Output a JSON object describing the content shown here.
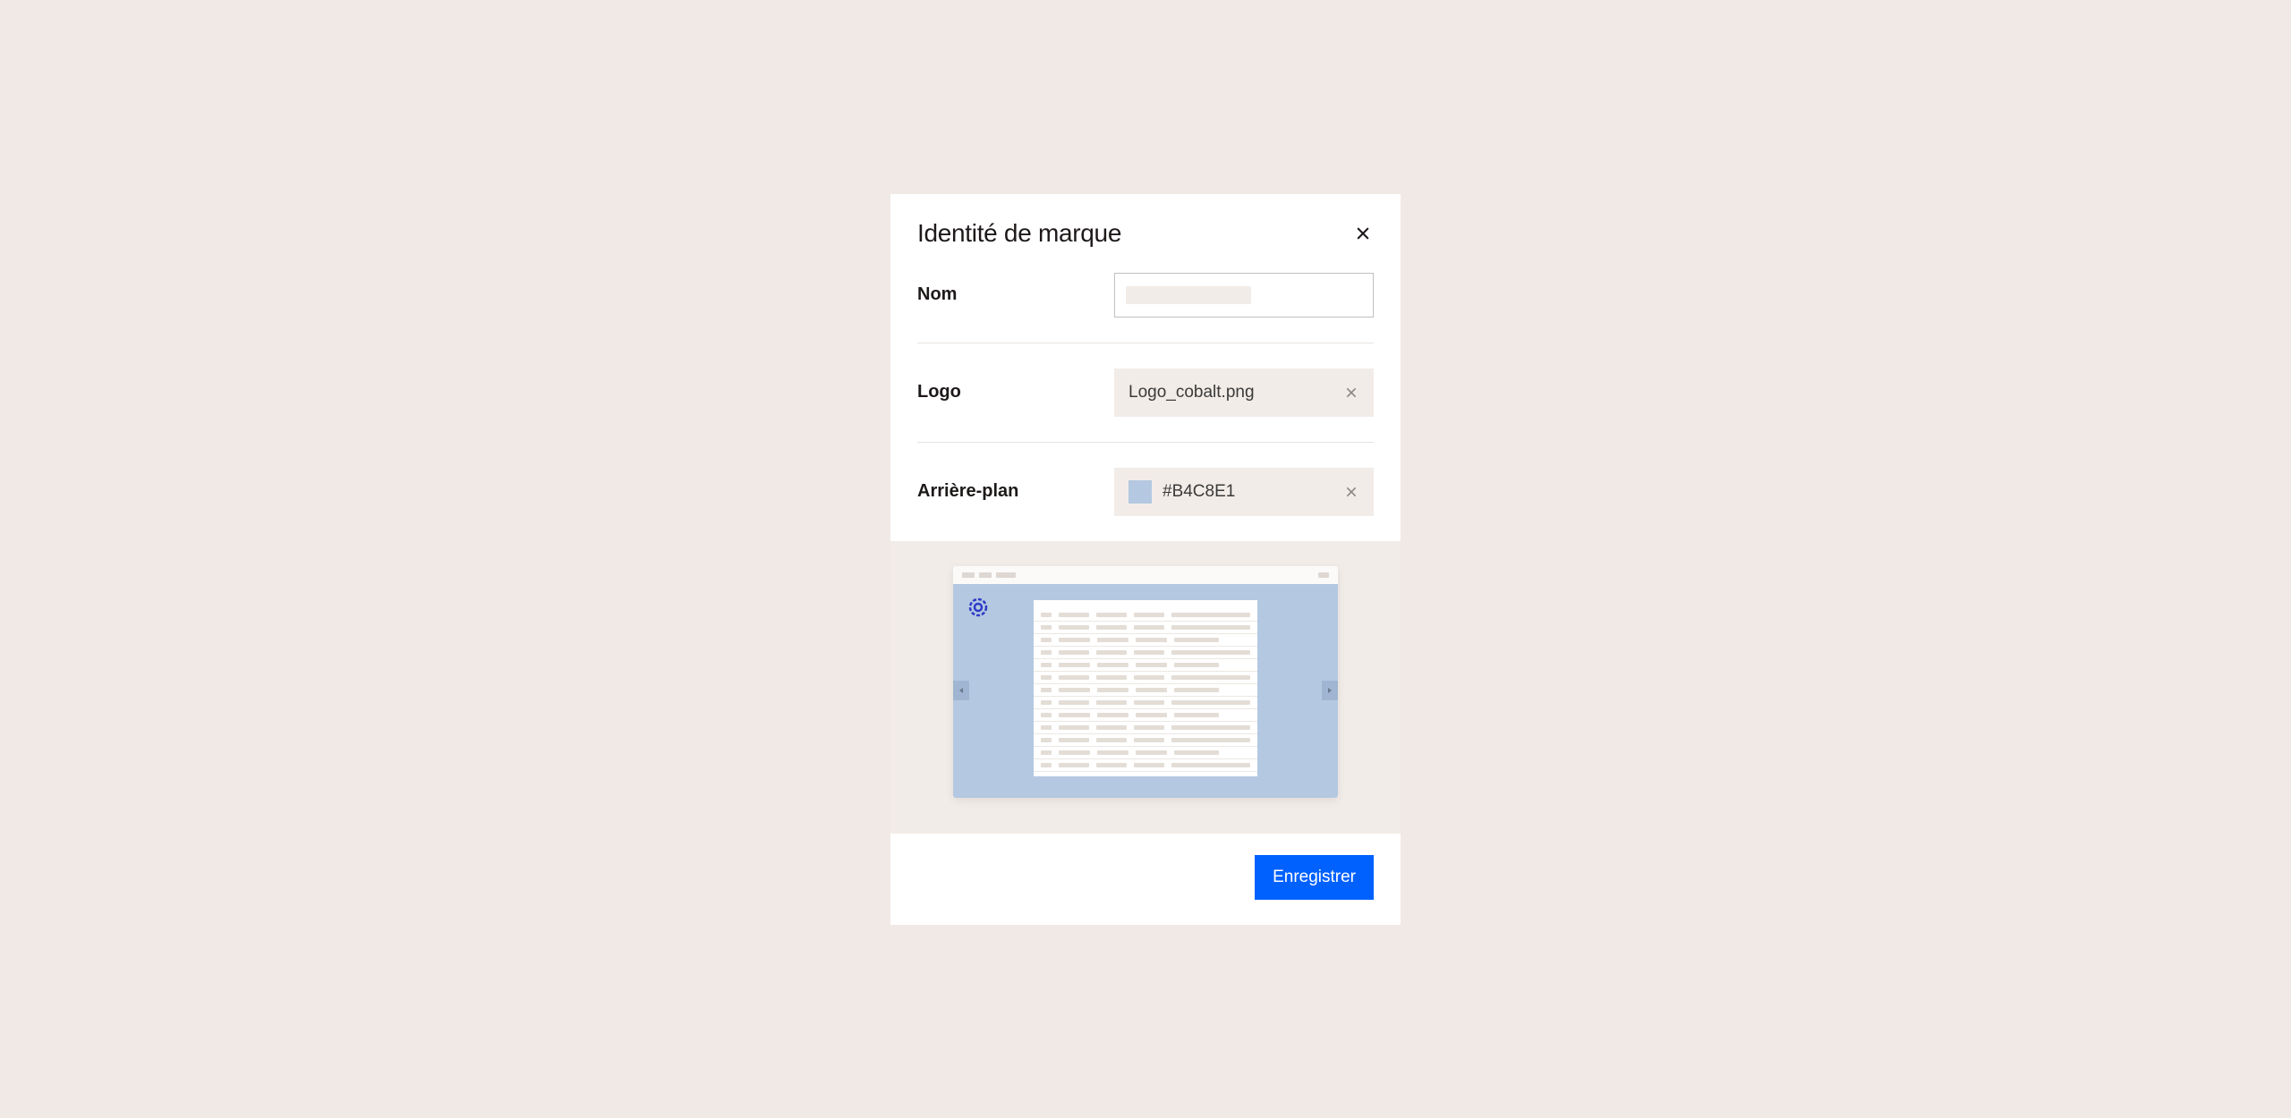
{
  "modal": {
    "title": "Identité de marque",
    "fields": {
      "name": {
        "label": "Nom"
      },
      "logo": {
        "label": "Logo",
        "filename": "Logo_cobalt.png"
      },
      "background": {
        "label": "Arrière-plan",
        "color_hex": "#B4C8E1"
      }
    },
    "save_button_label": "Enregistrer"
  },
  "colors": {
    "background_swatch": "#b4c8e1",
    "primary_button": "#0061fe"
  }
}
